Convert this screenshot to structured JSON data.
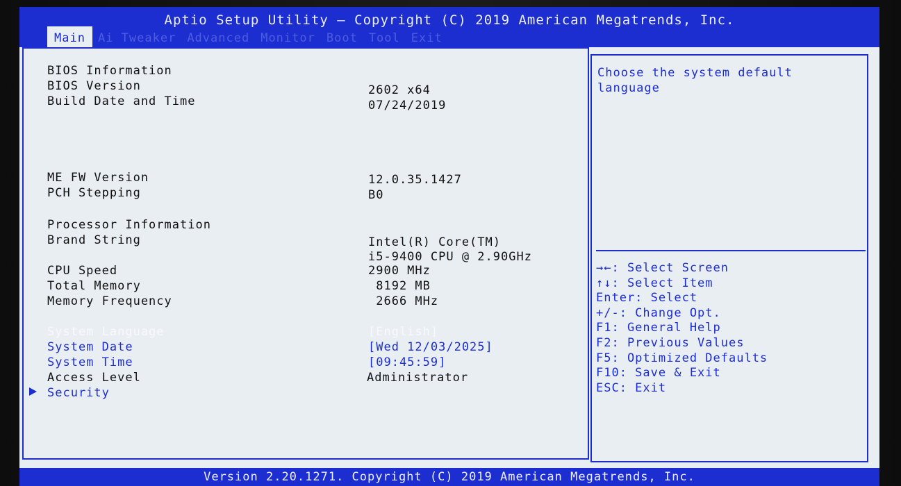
{
  "header": {
    "title": "Aptio Setup Utility – Copyright (C) 2019 American Megatrends, Inc.",
    "tabs": [
      "Main",
      "Ai Tweaker",
      "Advanced",
      "Monitor",
      "Boot",
      "Tool",
      "Exit"
    ],
    "active_tab": "Main"
  },
  "main": {
    "bios_info_heading": "BIOS Information",
    "bios_version_label": "BIOS Version",
    "bios_version_value": "2602  x64",
    "build_date_label": "Build Date and Time",
    "build_date_value": "07/24/2019",
    "me_fw_label": "ME FW Version",
    "me_fw_value": "12.0.35.1427",
    "pch_label": "PCH Stepping",
    "pch_value": "B0",
    "proc_info_heading": "Processor Information",
    "brand_label": "Brand String",
    "brand_value_1": "Intel(R) Core(TM)",
    "brand_value_2": "i5-9400 CPU @ 2.90GHz",
    "cpu_speed_label": "CPU Speed",
    "cpu_speed_value": "2900 MHz",
    "total_mem_label": "Total Memory",
    "total_mem_value": " 8192 MB",
    "mem_freq_label": "Memory Frequency",
    "mem_freq_value": " 2666 MHz",
    "sys_lang_label": "System Language",
    "sys_lang_value": "[English]",
    "sys_date_label": "System Date",
    "sys_date_value": "[Wed 12/03/2025]",
    "sys_time_label": "System Time",
    "sys_time_value": "[09:45:59]",
    "access_label": "Access Level",
    "access_value": "Administrator",
    "security_label": "Security"
  },
  "help": {
    "description": "Choose the system default language",
    "keys": [
      "→←: Select Screen",
      "↑↓: Select Item",
      "Enter: Select",
      "+/-: Change Opt.",
      "F1: General Help",
      "F2: Previous Values",
      "F5: Optimized Defaults",
      "F10: Save & Exit",
      "ESC: Exit"
    ]
  },
  "footer": {
    "text": "Version 2.20.1271. Copyright (C) 2019 American Megatrends, Inc."
  },
  "colors": {
    "bios_blue": "#1c2ed0",
    "panel_bg": "#e9eef3",
    "text_dark": "#111111",
    "highlight_text": "#f7f9ff"
  }
}
